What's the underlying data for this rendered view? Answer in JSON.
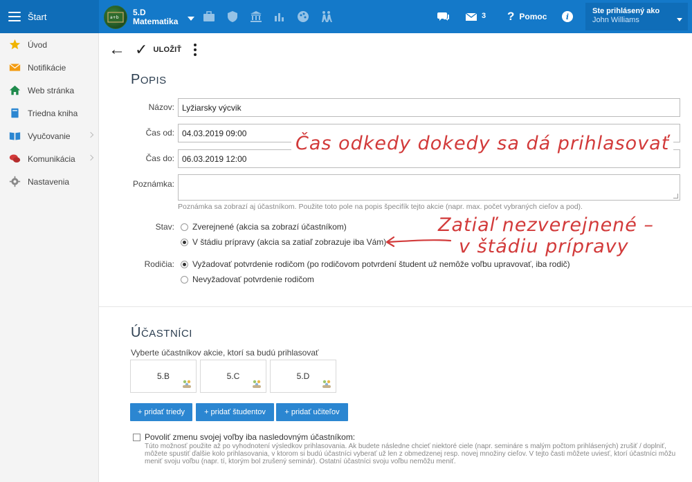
{
  "topbar": {
    "start_label": "Štart",
    "class_name": "5.D",
    "class_subject": "Matematika",
    "mail_count": "3",
    "help_label": "Pomoc",
    "info_glyph": "i",
    "user_line1": "Ste prihlásený ako",
    "user_line2": "John Williams",
    "icons": [
      "briefcase-icon",
      "shield-icon",
      "institution-icon",
      "bar-chart-icon",
      "palette-icon",
      "hikers-icon",
      "chat-icon",
      "mail-icon",
      "info-icon"
    ]
  },
  "sidebar": {
    "items": [
      {
        "label": "Úvod",
        "icon": "star-icon",
        "color": "#f0b400"
      },
      {
        "label": "Notifikácie",
        "icon": "envelope-icon",
        "color": "#f39c12"
      },
      {
        "label": "Web stránka",
        "icon": "home-icon",
        "color": "#1f8a4c"
      },
      {
        "label": "Triedna kniha",
        "icon": "book-icon",
        "color": "#2b86d1"
      },
      {
        "label": "Vyučovanie",
        "icon": "open-book-icon",
        "color": "#2b86d1"
      },
      {
        "label": "Komunikácia",
        "icon": "chat-icon",
        "color": "#d23a3a"
      },
      {
        "label": "Nastavenia",
        "icon": "gear-icon",
        "color": "#888888"
      }
    ]
  },
  "toolbar": {
    "save_label": "ULOŽIŤ"
  },
  "popis": {
    "title_cap": "P",
    "title_rest": "opis",
    "name_label": "Názov:",
    "name_value": "Lyžiarsky výcvik",
    "from_label": "Čas od:",
    "from_value": "04.03.2019 09:00",
    "to_label": "Čas do:",
    "to_value": "06.03.2019 12:00",
    "note_label": "Poznámka:",
    "note_hint": "Poznámka sa zobrazí aj účastníkom. Použite toto pole na popis špecifík tejto akcie (napr. max. počet vybraných cieľov a pod).",
    "state_label": "Stav:",
    "state_option1": "Zverejnené (akcia sa zobrazí účastníkom)",
    "state_option2": "V štádiu prípravy (akcia sa zatiaľ zobrazuje iba Vám)",
    "parents_label": "Rodičia:",
    "parents_option1": "Vyžadovať potvrdenie rodičom (po rodičovom potvrdení študent už nemôže voľbu upravovať, iba rodič)",
    "parents_option2": "Nevyžadovať potvrdenie rodičom"
  },
  "annotations": {
    "time": "Čas odkedy dokedy sa dá prihlasovať",
    "state_line1": "Zatiaľ nezverejnené –",
    "state_line2": "v štádiu prípravy",
    "color": "#d23a3a"
  },
  "ucastnici": {
    "title_cap": "Ú",
    "title_rest": "častníci",
    "subtitle": "Vyberte účastníkov akcie, ktorí sa budú prihlasovať",
    "classes": [
      "5.B",
      "5.C",
      "5.D"
    ],
    "btn_classes": "+ pridať triedy",
    "btn_students": "+ pridať študentov",
    "btn_teachers": "+ pridať učiteľov",
    "allow_label": "Povoliť zmenu svojej voľby iba nasledovným účastníkom:",
    "allow_note": "Túto možnosť použite až po vyhodnotení výsledkov prihlasovania. Ak budete následne chcieť niektoré ciele (napr. semináre s malým počtom prihlásených) zrušiť / doplniť, môžete spustiť ďalšie kolo prihlasovania, v ktorom si budú účastníci vyberať už len z obmedzenej resp. novej množiny cieľov. V tejto časti môžete uviesť, ktorí účastníci môžu meniť svoju voľbu (napr. tí, ktorým bol zrušený seminár). Ostatní účastníci svoju voľbu nemôžu meniť."
  },
  "colors": {
    "topbar": "#1479c9",
    "button": "#2b86d1"
  }
}
